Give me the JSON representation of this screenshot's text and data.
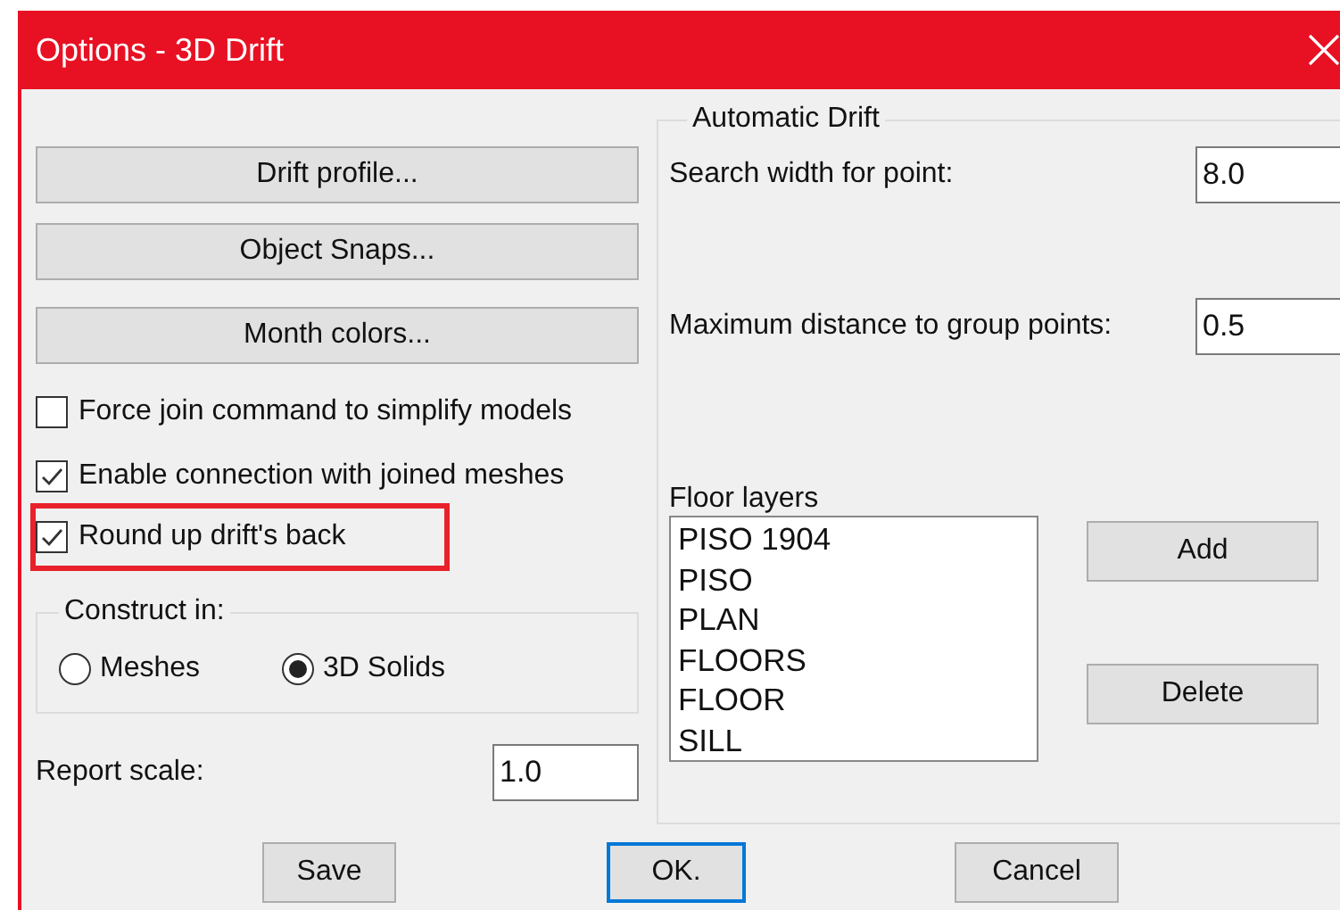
{
  "window": {
    "title": "Options - 3D Drift"
  },
  "buttons": [
    {
      "label": "Drift profile..."
    },
    {
      "label": "Object Snaps..."
    },
    {
      "label": "Month colors..."
    }
  ],
  "checkboxes": [
    {
      "label": "Force join command to simplify models",
      "checked": false,
      "highlighted": false
    },
    {
      "label": "Enable connection with joined meshes",
      "checked": true,
      "highlighted": false
    },
    {
      "label": "Round up drift's back",
      "checked": true,
      "highlighted": true
    }
  ],
  "construct_in": {
    "label": "Construct in:",
    "options": [
      {
        "label": "Meshes",
        "selected": false
      },
      {
        "label": "3D Solids",
        "selected": true
      }
    ]
  },
  "report_scale": {
    "label": "Report scale:",
    "value": "1.0"
  },
  "automatic_drift": {
    "title": "Automatic Drift",
    "search_width": {
      "label": "Search width for point:",
      "value": "8.0"
    },
    "max_distance": {
      "label": "Maximum distance to group points:",
      "value": "0.5"
    },
    "floor_layers": {
      "label": "Floor layers",
      "items": [
        "PISO 1904",
        "PISO",
        "PLAN",
        "FLOORS",
        "FLOOR",
        "SILL"
      ],
      "add_button": "Add",
      "delete_button": "Delete"
    }
  },
  "footer_buttons": [
    {
      "label": "Save",
      "default": false
    },
    {
      "label": "OK.",
      "default": true
    },
    {
      "label": "Cancel",
      "default": false
    }
  ]
}
